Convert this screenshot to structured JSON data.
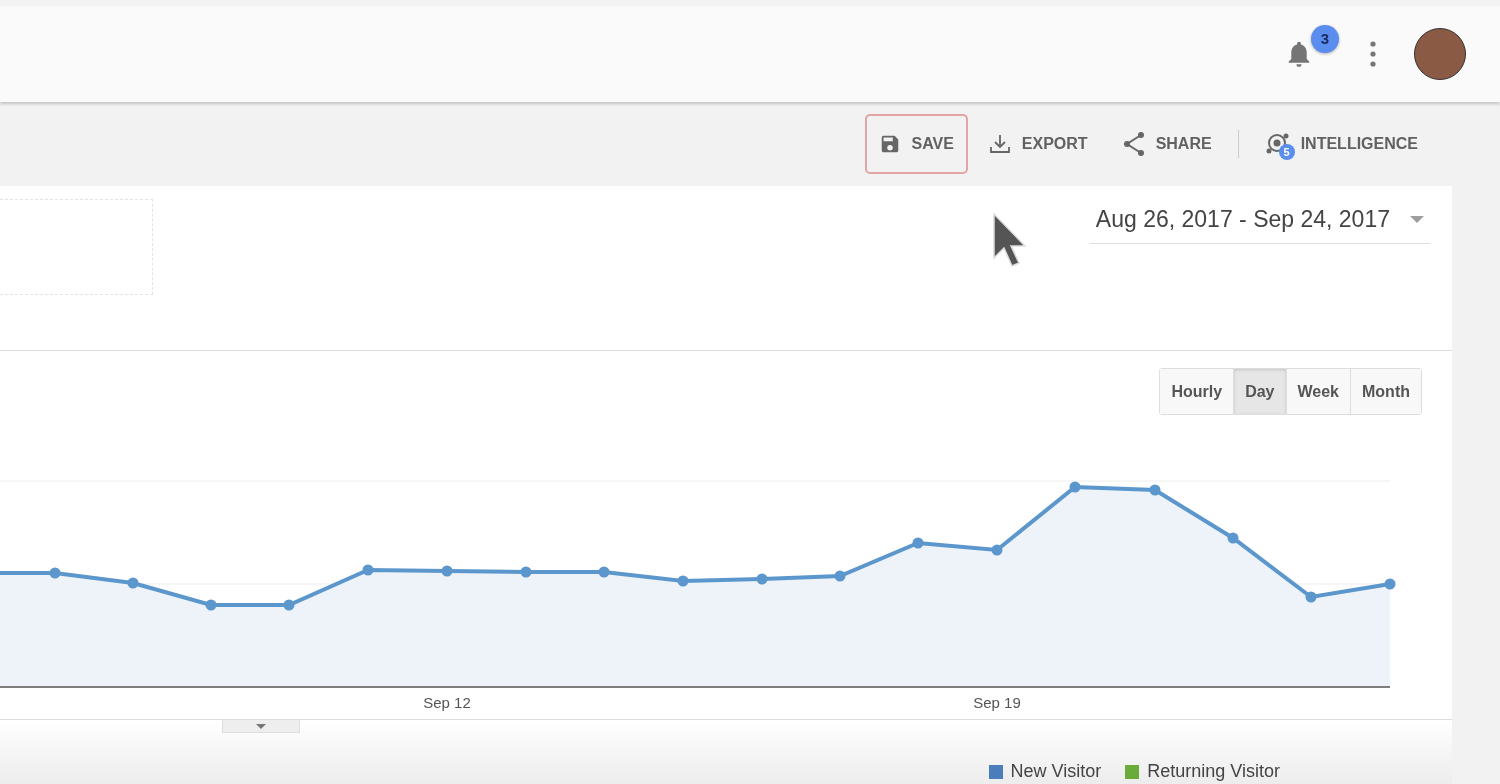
{
  "header": {
    "notifications": {
      "count": "3"
    }
  },
  "toolbar": {
    "actions": [
      {
        "kind": "save",
        "label": "SAVE",
        "selected": true
      },
      {
        "kind": "export",
        "label": "EXPORT",
        "selected": false
      },
      {
        "kind": "share",
        "label": "SHARE",
        "selected": false
      },
      {
        "kind": "intelligence",
        "label": "INTELLIGENCE",
        "selected": false,
        "badge": "5"
      }
    ]
  },
  "date_range": {
    "value": "Aug 26, 2017 - Sep 24, 2017"
  },
  "granularity": [
    {
      "label": "Hourly",
      "selected": false
    },
    {
      "label": "Day",
      "selected": true
    },
    {
      "label": "Week",
      "selected": false
    },
    {
      "label": "Month",
      "selected": false
    }
  ],
  "chart": {
    "x_labels": [
      "Sep 12",
      "Sep 19"
    ]
  },
  "legend": [
    {
      "label": "New Visitor",
      "color": "#4a7ebb"
    },
    {
      "label": "Returning Visitor",
      "color": "#6aab3c"
    }
  ]
}
